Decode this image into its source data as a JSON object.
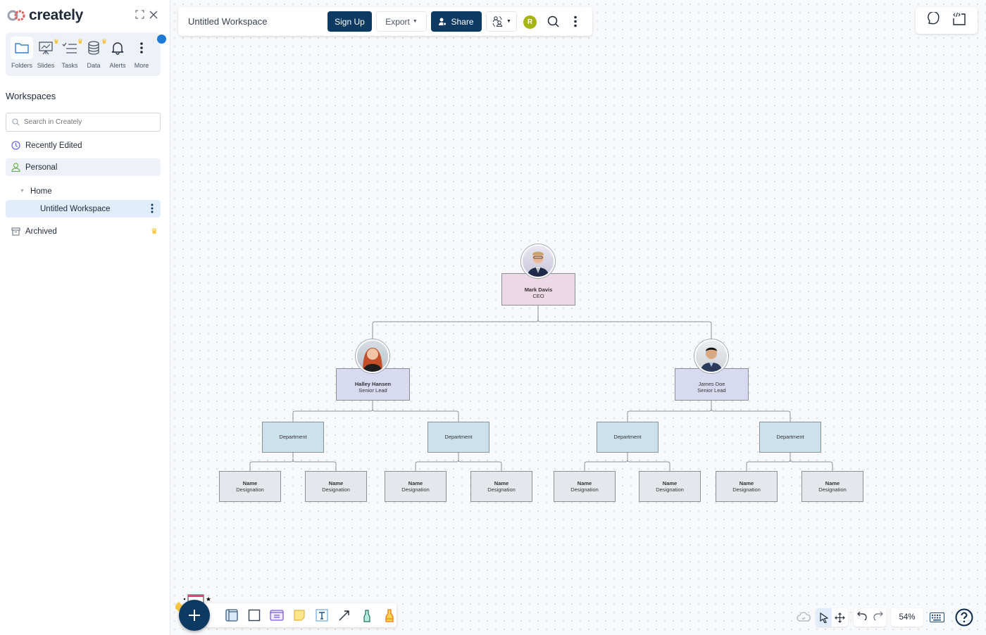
{
  "app": {
    "brand": "creately"
  },
  "sidebar": {
    "tabs": [
      {
        "label": "Folders",
        "icon": "folder-icon",
        "premium": false,
        "active": true
      },
      {
        "label": "Slides",
        "icon": "slides-icon",
        "premium": true,
        "active": false
      },
      {
        "label": "Tasks",
        "icon": "tasks-icon",
        "premium": true,
        "active": false
      },
      {
        "label": "Data",
        "icon": "database-icon",
        "premium": true,
        "active": false
      },
      {
        "label": "Alerts",
        "icon": "bell-icon",
        "premium": false,
        "active": false
      },
      {
        "label": "More",
        "icon": "more-vertical-icon",
        "premium": false,
        "active": false
      }
    ],
    "workspaces_title": "Workspaces",
    "search_placeholder": "Search in Creately",
    "nav": {
      "recently_edited": "Recently Edited",
      "personal": "Personal",
      "home": "Home",
      "current_workspace": "Untitled Workspace",
      "archived": "Archived"
    }
  },
  "header": {
    "doc_title": "Untitled Workspace",
    "sign_up": "Sign Up",
    "export": "Export",
    "share": "Share",
    "user_initial": "R",
    "user_color": "#a8b315"
  },
  "org_chart": {
    "ceo": {
      "name": "Mark Davis",
      "title": "CEO"
    },
    "leads": [
      {
        "name": "Halley Hansen",
        "title": "Senior Lead"
      },
      {
        "name": "James Doe",
        "title": "Senior Lead"
      }
    ],
    "department_label": "Department",
    "employee": {
      "name": "Name",
      "title": "Designation"
    },
    "colors": {
      "ceo": "#efd8e6",
      "lead": "#d8daf2",
      "dept": "#cde1ec",
      "employee": "#e4e7eb"
    }
  },
  "bottom_right": {
    "zoom_level": "54%"
  },
  "colors": {
    "brand_dark": "#0c3a63",
    "accent_blue": "#1e7ad6",
    "premium_gold": "#f5b400"
  }
}
